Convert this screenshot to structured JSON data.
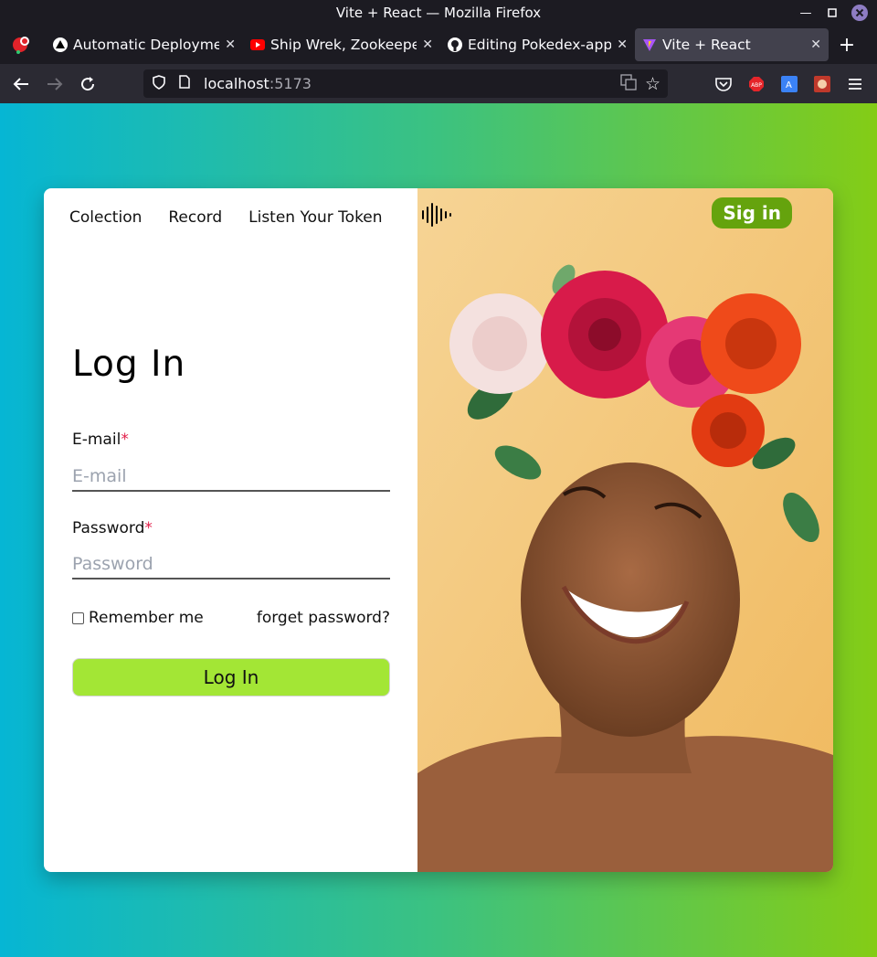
{
  "window": {
    "title": "Vite + React — Mozilla Firefox"
  },
  "tabs": [
    {
      "label": "Automatic Deploymen",
      "icon": "vercel-triangle-icon"
    },
    {
      "label": "Ship Wrek, Zookeeper",
      "icon": "youtube-icon"
    },
    {
      "label": "Editing Pokedex-app/f",
      "icon": "github-icon"
    },
    {
      "label": "Vite + React",
      "icon": "vite-icon",
      "active": true
    }
  ],
  "address": {
    "host": "localhost",
    "port": ":5173"
  },
  "nav": {
    "items": [
      "Colection",
      "Record",
      "Listen Your Token"
    ],
    "signin": "Sig in"
  },
  "login": {
    "title": "Log In",
    "email_label": "E-mail",
    "email_placeholder": "E-mail",
    "password_label": "Password",
    "password_placeholder": "Password",
    "required_mark": "*",
    "remember": "Remember me",
    "forget": "forget password?",
    "button": "Log In"
  },
  "colors": {
    "accent": "#a3e635",
    "signin_bg": "#65a30d",
    "bg_start": "#06b6d4",
    "bg_end": "#84cc16"
  }
}
